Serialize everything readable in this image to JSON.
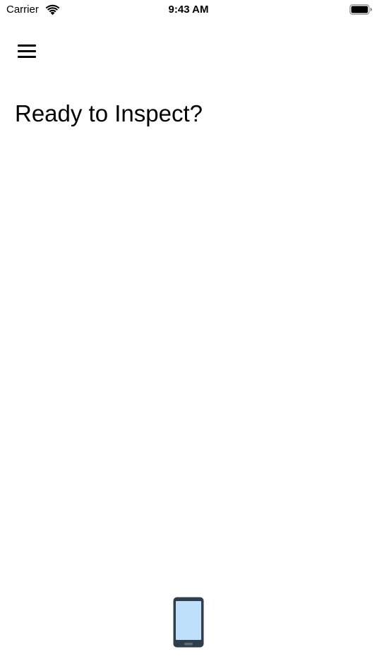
{
  "status_bar": {
    "carrier": "Carrier",
    "time": "9:43 AM",
    "wifi_icon": "wifi-icon",
    "battery_icon": "battery-icon"
  },
  "nav": {
    "menu_icon": "hamburger-menu-icon"
  },
  "main": {
    "title": "Ready to Inspect?"
  },
  "footer": {
    "device_icon": "mobile-phone-icon"
  },
  "colors": {
    "background": "#ffffff",
    "text": "#000000",
    "device_frame": "#2f3e4a",
    "device_screen": "#bfe0fb"
  }
}
